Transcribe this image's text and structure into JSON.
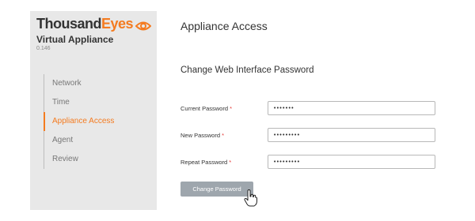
{
  "sidebar": {
    "brand_part1": "Thousand",
    "brand_part2": "Eyes",
    "product": "Virtual Appliance",
    "version": "0.146",
    "nav": [
      {
        "label": "Network"
      },
      {
        "label": "Time"
      },
      {
        "label": "Appliance Access",
        "active": true
      },
      {
        "label": "Agent"
      },
      {
        "label": "Review"
      }
    ]
  },
  "main": {
    "title": "Appliance Access",
    "section_title": "Change Web Interface Password",
    "fields": [
      {
        "label": "Current Password",
        "required": "*",
        "value": "•••••••"
      },
      {
        "label": "New Password",
        "required": "*",
        "value": "•••••••••"
      },
      {
        "label": "Repeat Password",
        "required": "*",
        "value": "•••••••••"
      }
    ],
    "submit_label": "Change Password"
  },
  "colors": {
    "accent": "#f47b20",
    "sidebar_bg": "#e8e8e8",
    "button_bg": "#9ea6ad",
    "required": "#e53935"
  },
  "icons": {
    "logo": "eye-icon",
    "pointer": "hand-pointer-icon"
  }
}
